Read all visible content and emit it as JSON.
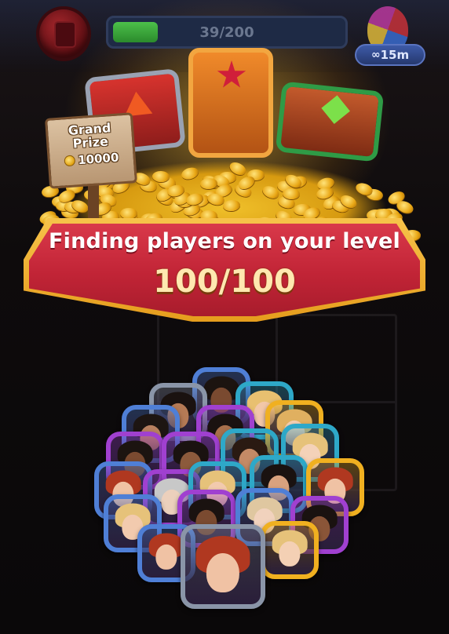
{
  "top_bar": {
    "progress_text": "39/200",
    "progress_fraction": 0.195,
    "timer_text": "15m",
    "timer_icon": "infinity-icon"
  },
  "grand_prize": {
    "title_line1": "Grand",
    "title_line2": "Prize",
    "amount": "10000",
    "amount_icon": "coin-icon"
  },
  "banner": {
    "title": "Finding players on your level",
    "count": "100/100"
  },
  "colors": {
    "banner_red": "#c12436",
    "banner_gold": "#f7c34a",
    "progress_green": "#3fae3d",
    "frame_blue": "#4f7fd6",
    "frame_purple": "#a040d0",
    "frame_gold": "#f0b020",
    "frame_cyan": "#2ea8c8",
    "frame_gray": "#8a95a8"
  },
  "avatars": [
    {
      "frame": "#4f7fd6",
      "skin": "#7a4a30",
      "hair": "#1c1410"
    },
    {
      "frame": "#8a95a8",
      "skin": "#b57a55",
      "hair": "#1a1210"
    },
    {
      "frame": "#2ea8c8",
      "skin": "#f2c7a8",
      "hair": "#e8c070"
    },
    {
      "frame": "#4f7fd6",
      "skin": "#b88060",
      "hair": "#1d1512"
    },
    {
      "frame": "#a040d0",
      "skin": "#a8704c",
      "hair": "#1a1210"
    },
    {
      "frame": "#f0b020",
      "skin": "#f4cfb3",
      "hair": "#e0b060"
    },
    {
      "frame": "#a040d0",
      "skin": "#7a4a30",
      "hair": "#1c1410"
    },
    {
      "frame": "#a040d0",
      "skin": "#8c5a3c",
      "hair": "#1a1210"
    },
    {
      "frame": "#2ea8c8",
      "skin": "#c48a66",
      "hair": "#2a1a12"
    },
    {
      "frame": "#2ea8c8",
      "skin": "#f4d2b8",
      "hair": "#e6c27a"
    },
    {
      "frame": "#4f7fd6",
      "skin": "#f0c2a4",
      "hair": "#b03820"
    },
    {
      "frame": "#a040d0",
      "skin": "#ecd0bc",
      "hair": "#c8c8c8"
    },
    {
      "frame": "#2ea8c8",
      "skin": "#f2caae",
      "hair": "#e6c27a"
    },
    {
      "frame": "#2ea8c8",
      "skin": "#d9a27e",
      "hair": "#1a1210"
    },
    {
      "frame": "#f0b020",
      "skin": "#f0c2a4",
      "hair": "#b03820"
    },
    {
      "frame": "#4f7fd6",
      "skin": "#f2caae",
      "hair": "#e6c27a"
    },
    {
      "frame": "#a040d0",
      "skin": "#7a4a30",
      "hair": "#1a1210"
    },
    {
      "frame": "#4f7fd6",
      "skin": "#f1d2bd",
      "hair": "#dfc7a0"
    },
    {
      "frame": "#a040d0",
      "skin": "#8a5538",
      "hair": "#1a1210"
    },
    {
      "frame": "#4f7fd6",
      "skin": "#f0c2a4",
      "hair": "#b03820"
    },
    {
      "frame": "#8a95a8",
      "skin": "#f0c2a4",
      "hair": "#b03820"
    },
    {
      "frame": "#f0b020",
      "skin": "#f4d0b4",
      "hair": "#e6c27a"
    }
  ]
}
